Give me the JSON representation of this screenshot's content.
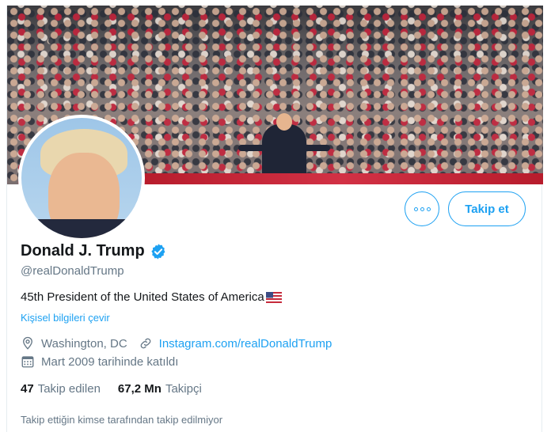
{
  "profile": {
    "name": "Donald J. Trump",
    "handle": "@realDonaldTrump",
    "bio": "45th President of the United States of America",
    "translate_link": "Kişisel bilgileri çevir",
    "location": "Washington, DC",
    "website": "Instagram.com/realDonaldTrump",
    "joined": "Mart 2009 tarihinde katıldı",
    "verified_badge": "verified-check",
    "bio_flag": "us-flag"
  },
  "actions": {
    "more_icon": "more-options",
    "follow_label": "Takip et"
  },
  "stats": {
    "following_count": "47",
    "following_label": "Takip edilen",
    "followers_count": "67,2 Mn",
    "followers_label": "Takipçi"
  },
  "notice": "Takip ettiğin kimse tarafından takip edilmiyor",
  "colors": {
    "accent": "#1da1f2",
    "text_primary": "#14171a",
    "text_secondary": "#657786"
  }
}
